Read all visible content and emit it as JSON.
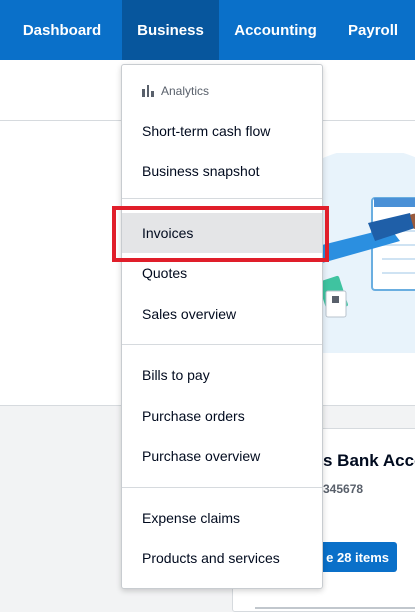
{
  "nav": {
    "tabs": [
      {
        "label": "Dashboard"
      },
      {
        "label": "Business"
      },
      {
        "label": "Accounting"
      },
      {
        "label": "Payroll"
      }
    ],
    "active_tab": "Business"
  },
  "menu": {
    "heading": "Analytics",
    "heading_icon": "bar-chart-icon",
    "groups": [
      [
        "Short-term cash flow",
        "Business snapshot"
      ],
      [
        "Invoices",
        "Quotes",
        "Sales overview"
      ],
      [
        "Bills to pay",
        "Purchase orders",
        "Purchase overview"
      ],
      [
        "Expense claims",
        "Products and services"
      ]
    ],
    "highlighted_item": "Invoices"
  },
  "card": {
    "title": "s Bank Acco",
    "number": "345678",
    "button_label": "e 28 items"
  },
  "colors": {
    "nav_bg": "#0a70c9",
    "nav_active": "#07569d",
    "highlight_box": "#e01e2a"
  }
}
